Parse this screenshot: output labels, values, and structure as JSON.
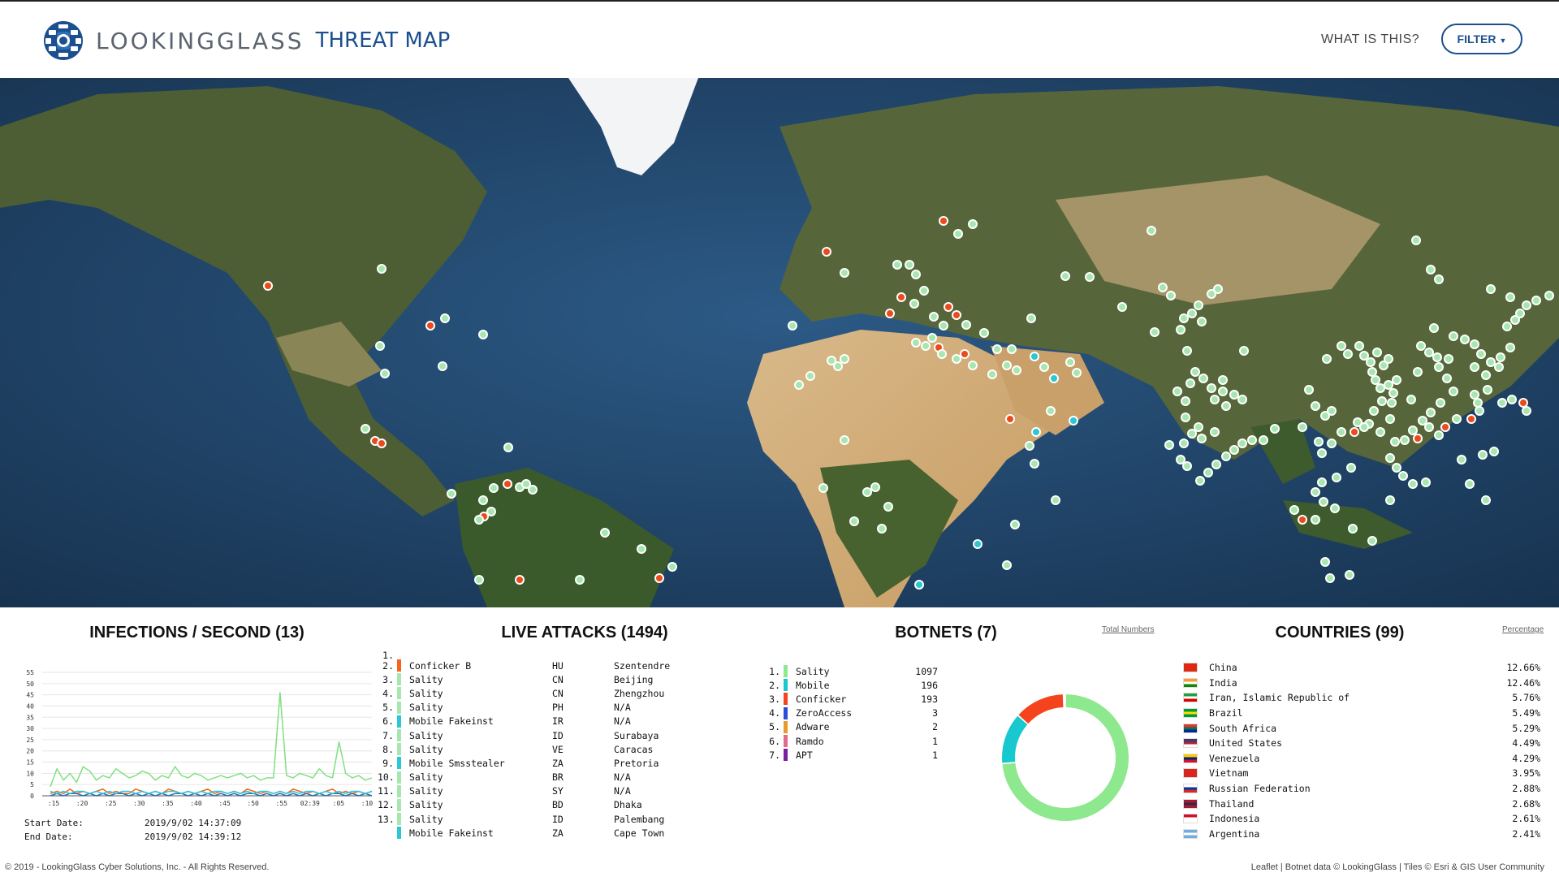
{
  "header": {
    "logo_brand": "LOOKINGGLASS",
    "logo_product": "THREAT MAP",
    "what_link": "WHAT IS THIS?",
    "filter_label": "FILTER"
  },
  "colors": {
    "brand_blue": "#1b4f8f",
    "dot_green": "#a8e6b0",
    "dot_red": "#ea4a1c",
    "dot_cyan": "#2bc7d4",
    "line_green": "#7fe07f",
    "line_orange": "#f5651d",
    "line_blue": "#2a6fb5"
  },
  "map": {
    "label": "World threat map"
  },
  "infections": {
    "title": "INFECTIONS / SECOND (13)",
    "start_label": "Start Date:",
    "start_value": "2019/9/02 14:37:09",
    "end_label": "End Date:",
    "end_value": "2019/9/02 14:39:12"
  },
  "chart_data": {
    "type": "line",
    "title": "INFECTIONS / SECOND (13)",
    "xlabel": "",
    "ylabel": "",
    "ylim": [
      0,
      55
    ],
    "yticks": [
      0,
      5,
      10,
      15,
      20,
      25,
      30,
      35,
      40,
      45,
      50,
      55
    ],
    "xticks": [
      ":15",
      ":20",
      ":25",
      ":30",
      ":35",
      ":40",
      ":45",
      ":50",
      ":55",
      "02:39",
      ":05",
      ":10"
    ],
    "grid": true,
    "series": [
      {
        "color": "#7fe07f",
        "values": [
          4,
          12,
          7,
          10,
          6,
          13,
          11,
          7,
          9,
          8,
          12,
          10,
          8,
          9,
          11,
          10,
          7,
          9,
          8,
          13,
          9,
          8,
          10,
          9,
          7,
          8,
          9,
          8,
          9,
          10,
          8,
          9,
          7,
          8,
          8,
          46,
          9,
          8,
          10,
          9,
          8,
          12,
          9,
          8,
          24,
          10,
          8,
          9,
          7,
          8
        ]
      },
      {
        "color": "#f5651d",
        "values": [
          1,
          2,
          1,
          3,
          1,
          2,
          1,
          2,
          3,
          1,
          2,
          1,
          1,
          3,
          2,
          1,
          2,
          1,
          3,
          2,
          1,
          2,
          1,
          2,
          3,
          1,
          2,
          1,
          2,
          1,
          3,
          2,
          1,
          2,
          1,
          2,
          1,
          3,
          2,
          1,
          2,
          1,
          2,
          3,
          1,
          2,
          1,
          2,
          1,
          2
        ]
      },
      {
        "color": "#2a6fb5",
        "values": [
          0,
          1,
          0,
          1,
          1,
          0,
          1,
          0,
          1,
          0,
          1,
          1,
          0,
          1,
          0,
          1,
          0,
          1,
          0,
          1,
          1,
          0,
          1,
          0,
          1,
          0,
          1,
          0,
          1,
          0,
          1,
          1,
          0,
          1,
          0,
          1,
          0,
          1,
          0,
          1,
          0,
          1,
          0,
          1,
          1,
          0,
          1,
          0,
          1,
          0
        ]
      },
      {
        "color": "#2bc7d4",
        "values": [
          2,
          1,
          2,
          1,
          2,
          2,
          1,
          2,
          1,
          2,
          1,
          2,
          2,
          1,
          2,
          1,
          2,
          1,
          2,
          2,
          1,
          2,
          1,
          2,
          1,
          2,
          2,
          1,
          2,
          1,
          2,
          1,
          2,
          2,
          1,
          2,
          1,
          2,
          1,
          2,
          2,
          1,
          2,
          1,
          2,
          1,
          2,
          2,
          1,
          2
        ]
      }
    ]
  },
  "attacks": {
    "title": "LIVE ATTACKS (1494)",
    "first_index": "1.",
    "rows": [
      {
        "idx": "2.",
        "name": "Conficker B",
        "cc": "HU",
        "city": "Szentendre",
        "color": "#f5651d"
      },
      {
        "idx": "3.",
        "name": "Sality",
        "cc": "CN",
        "city": "Beijing",
        "color": "#a8e6b0"
      },
      {
        "idx": "4.",
        "name": "Sality",
        "cc": "CN",
        "city": "Zhengzhou",
        "color": "#a8e6b0"
      },
      {
        "idx": "5.",
        "name": "Sality",
        "cc": "PH",
        "city": "N/A",
        "color": "#a8e6b0"
      },
      {
        "idx": "6.",
        "name": "Mobile Fakeinst",
        "cc": "IR",
        "city": "N/A",
        "color": "#2bc7d4"
      },
      {
        "idx": "7.",
        "name": "Sality",
        "cc": "ID",
        "city": "Surabaya",
        "color": "#a8e6b0"
      },
      {
        "idx": "8.",
        "name": "Sality",
        "cc": "VE",
        "city": "Caracas",
        "color": "#a8e6b0"
      },
      {
        "idx": "9.",
        "name": "Mobile Smsstealer",
        "cc": "ZA",
        "city": "Pretoria",
        "color": "#2bc7d4"
      },
      {
        "idx": "10.",
        "name": "Sality",
        "cc": "BR",
        "city": "N/A",
        "color": "#a8e6b0"
      },
      {
        "idx": "11.",
        "name": "Sality",
        "cc": "SY",
        "city": "N/A",
        "color": "#a8e6b0"
      },
      {
        "idx": "12.",
        "name": "Sality",
        "cc": "BD",
        "city": "Dhaka",
        "color": "#a8e6b0"
      },
      {
        "idx": "13.",
        "name": "Sality",
        "cc": "ID",
        "city": "Palembang",
        "color": "#a8e6b0"
      },
      {
        "idx": "",
        "name": "Mobile Fakeinst",
        "cc": "ZA",
        "city": "Cape Town",
        "color": "#2bc7d4"
      }
    ]
  },
  "botnets": {
    "title": "BOTNETS (7)",
    "link": "Total Numbers",
    "rows": [
      {
        "idx": "1.",
        "name": "Sality",
        "value": "1097",
        "color": "#8ee88e"
      },
      {
        "idx": "2.",
        "name": "Mobile",
        "value": "196",
        "color": "#17c9cf"
      },
      {
        "idx": "3.",
        "name": "Conficker",
        "value": "193",
        "color": "#f5431d"
      },
      {
        "idx": "4.",
        "name": "ZeroAccess",
        "value": "3",
        "color": "#2a4fd6"
      },
      {
        "idx": "5.",
        "name": "Adware",
        "value": "2",
        "color": "#e89a2a"
      },
      {
        "idx": "6.",
        "name": "Ramdo",
        "value": "1",
        "color": "#e36b8a"
      },
      {
        "idx": "7.",
        "name": "APT",
        "value": "1",
        "color": "#7a1fa0"
      }
    ]
  },
  "countries": {
    "title": "COUNTRIES (99)",
    "link": "Percentage",
    "rows": [
      {
        "name": "China",
        "pct": "12.66%",
        "flag": [
          "#de2910",
          "#de2910",
          "#de2910"
        ]
      },
      {
        "name": "India",
        "pct": "12.46%",
        "flag": [
          "#ff9933",
          "#ffffff",
          "#138808"
        ]
      },
      {
        "name": "Iran, Islamic Republic of",
        "pct": "5.76%",
        "flag": [
          "#239f40",
          "#ffffff",
          "#da0000"
        ]
      },
      {
        "name": "Brazil",
        "pct": "5.49%",
        "flag": [
          "#009c3b",
          "#ffdf00",
          "#009c3b"
        ]
      },
      {
        "name": "South Africa",
        "pct": "5.29%",
        "flag": [
          "#de3831",
          "#007a4d",
          "#002395"
        ]
      },
      {
        "name": "United States",
        "pct": "4.49%",
        "flag": [
          "#3c3b6e",
          "#b22234",
          "#ffffff"
        ]
      },
      {
        "name": "Venezuela",
        "pct": "4.29%",
        "flag": [
          "#ffcc00",
          "#00247d",
          "#cf142b"
        ]
      },
      {
        "name": "Vietnam",
        "pct": "3.95%",
        "flag": [
          "#da251d",
          "#da251d",
          "#da251d"
        ]
      },
      {
        "name": "Russian Federation",
        "pct": "2.88%",
        "flag": [
          "#ffffff",
          "#0039a6",
          "#d52b1e"
        ]
      },
      {
        "name": "Thailand",
        "pct": "2.68%",
        "flag": [
          "#a51931",
          "#2d2a4a",
          "#a51931"
        ]
      },
      {
        "name": "Indonesia",
        "pct": "2.61%",
        "flag": [
          "#ce1126",
          "#ffffff",
          "#ffffff"
        ]
      },
      {
        "name": "Argentina",
        "pct": "2.41%",
        "flag": [
          "#74acdf",
          "#ffffff",
          "#74acdf"
        ]
      }
    ]
  },
  "footer": {
    "left": "© 2019 - LookingGlass Cyber Solutions, Inc. - All Rights Reserved.",
    "right": "Leaflet | Botnet data © LookingGlass | Tiles © Esri & GIS User Community"
  }
}
